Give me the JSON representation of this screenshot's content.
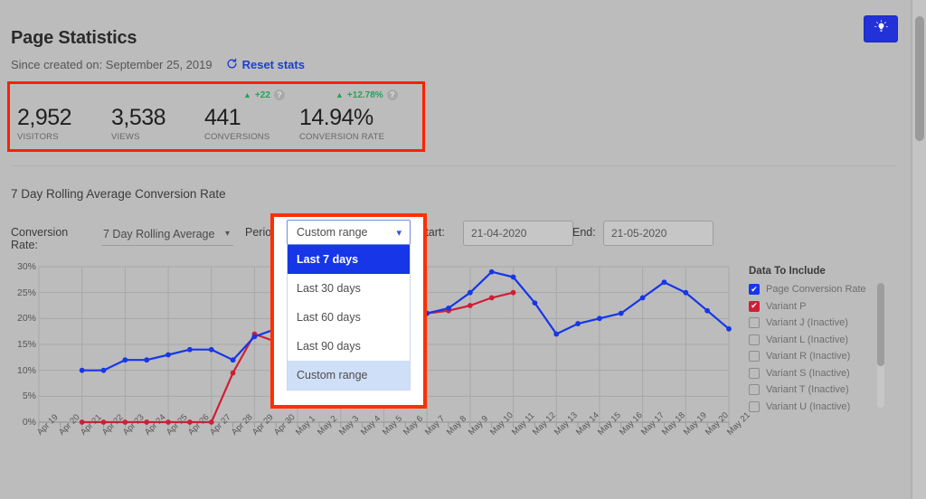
{
  "header": {
    "title": "Page Statistics",
    "since_label": "Since created on: September 25, 2019",
    "reset_link": "Reset stats",
    "reset_icon": "refresh-icon",
    "bulb_icon": "lightbulb-icon"
  },
  "stats": [
    {
      "value": "2,952",
      "label": "VISITORS",
      "delta": null,
      "has_help": false
    },
    {
      "value": "3,538",
      "label": "VIEWS",
      "delta": null,
      "has_help": false
    },
    {
      "value": "441",
      "label": "CONVERSIONS",
      "delta": "+22",
      "has_help": true
    },
    {
      "value": "14.94%",
      "label": "CONVERSION RATE",
      "delta": "+12.78%",
      "has_help": true
    }
  ],
  "delta_arrow": "▲",
  "help_glyph": "?",
  "chart_section": {
    "heading": "7 Day Rolling Average Conversion Rate",
    "conversion_rate_label": "Conversion Rate:",
    "conversion_rate_value": "7 Day Rolling Average",
    "period_label": "Period:",
    "period_value": "Custom range",
    "start_label": "Start:",
    "start_value": "21-04-2020",
    "end_label": "End:",
    "end_value": "21-05-2020"
  },
  "period_dropdown": {
    "open": true,
    "options": [
      "Last 7 days",
      "Last 30 days",
      "Last 60 days",
      "Last 90 days",
      "Custom range"
    ],
    "highlighted": "Last 7 days",
    "selected": "Custom range"
  },
  "legend": {
    "title": "Data To Include",
    "items": [
      {
        "label": "Page Conversion Rate",
        "checked": true,
        "color": "#1636e8"
      },
      {
        "label": "Variant P",
        "checked": true,
        "color": "#cf1f35"
      },
      {
        "label": "Variant J (Inactive)",
        "checked": false,
        "color": ""
      },
      {
        "label": "Variant L (Inactive)",
        "checked": false,
        "color": ""
      },
      {
        "label": "Variant R (Inactive)",
        "checked": false,
        "color": ""
      },
      {
        "label": "Variant S (Inactive)",
        "checked": false,
        "color": ""
      },
      {
        "label": "Variant T (Inactive)",
        "checked": false,
        "color": ""
      },
      {
        "label": "Variant U (Inactive)",
        "checked": false,
        "color": ""
      }
    ]
  },
  "colors": {
    "primary_blue": "#1636e8",
    "variant_red": "#cf1f35",
    "annotation_red": "#ff3000",
    "link_blue": "#1a3fd4",
    "positive_green": "#24a35a",
    "page_bg": "#bcbcbc"
  },
  "chart_data": {
    "type": "line",
    "title": "7 Day Rolling Average Conversion Rate",
    "xlabel": "",
    "ylabel": "",
    "ylim": [
      0,
      30
    ],
    "yticks": [
      0,
      5,
      10,
      15,
      20,
      25,
      30
    ],
    "ytick_labels": [
      "0%",
      "5%",
      "10%",
      "15%",
      "20%",
      "25%",
      "30%"
    ],
    "grid": true,
    "legend_position": "right",
    "x": [
      "Apr 19",
      "Apr 20",
      "Apr 21",
      "Apr 22",
      "Apr 23",
      "Apr 24",
      "Apr 25",
      "Apr 26",
      "Apr 27",
      "Apr 28",
      "Apr 29",
      "Apr 30",
      "May 1",
      "May 2",
      "May 3",
      "May 4",
      "May 5",
      "May 6",
      "May 7",
      "May 8",
      "May 9",
      "May 10",
      "May 11",
      "May 12",
      "May 13",
      "May 14",
      "May 15",
      "May 16",
      "May 17",
      "May 18",
      "May 19",
      "May 20",
      "May 21"
    ],
    "series": [
      {
        "name": "Page Conversion Rate",
        "color": "#1636e8",
        "values": [
          null,
          null,
          10,
          10,
          12,
          12,
          13,
          14,
          14,
          12,
          16.5,
          18,
          null,
          null,
          null,
          null,
          null,
          null,
          21,
          22,
          25,
          29,
          28,
          23,
          17,
          19,
          20,
          21,
          24,
          27,
          25,
          21.5,
          18
        ]
      },
      {
        "name": "Variant P",
        "color": "#cf1f35",
        "values": [
          null,
          null,
          0,
          0,
          0,
          0,
          0,
          0,
          0,
          9.5,
          17,
          15.5,
          null,
          null,
          null,
          null,
          null,
          null,
          21,
          21.5,
          22.5,
          24,
          25,
          null,
          null,
          null,
          null,
          null,
          null,
          null,
          null,
          null,
          null
        ]
      }
    ]
  }
}
